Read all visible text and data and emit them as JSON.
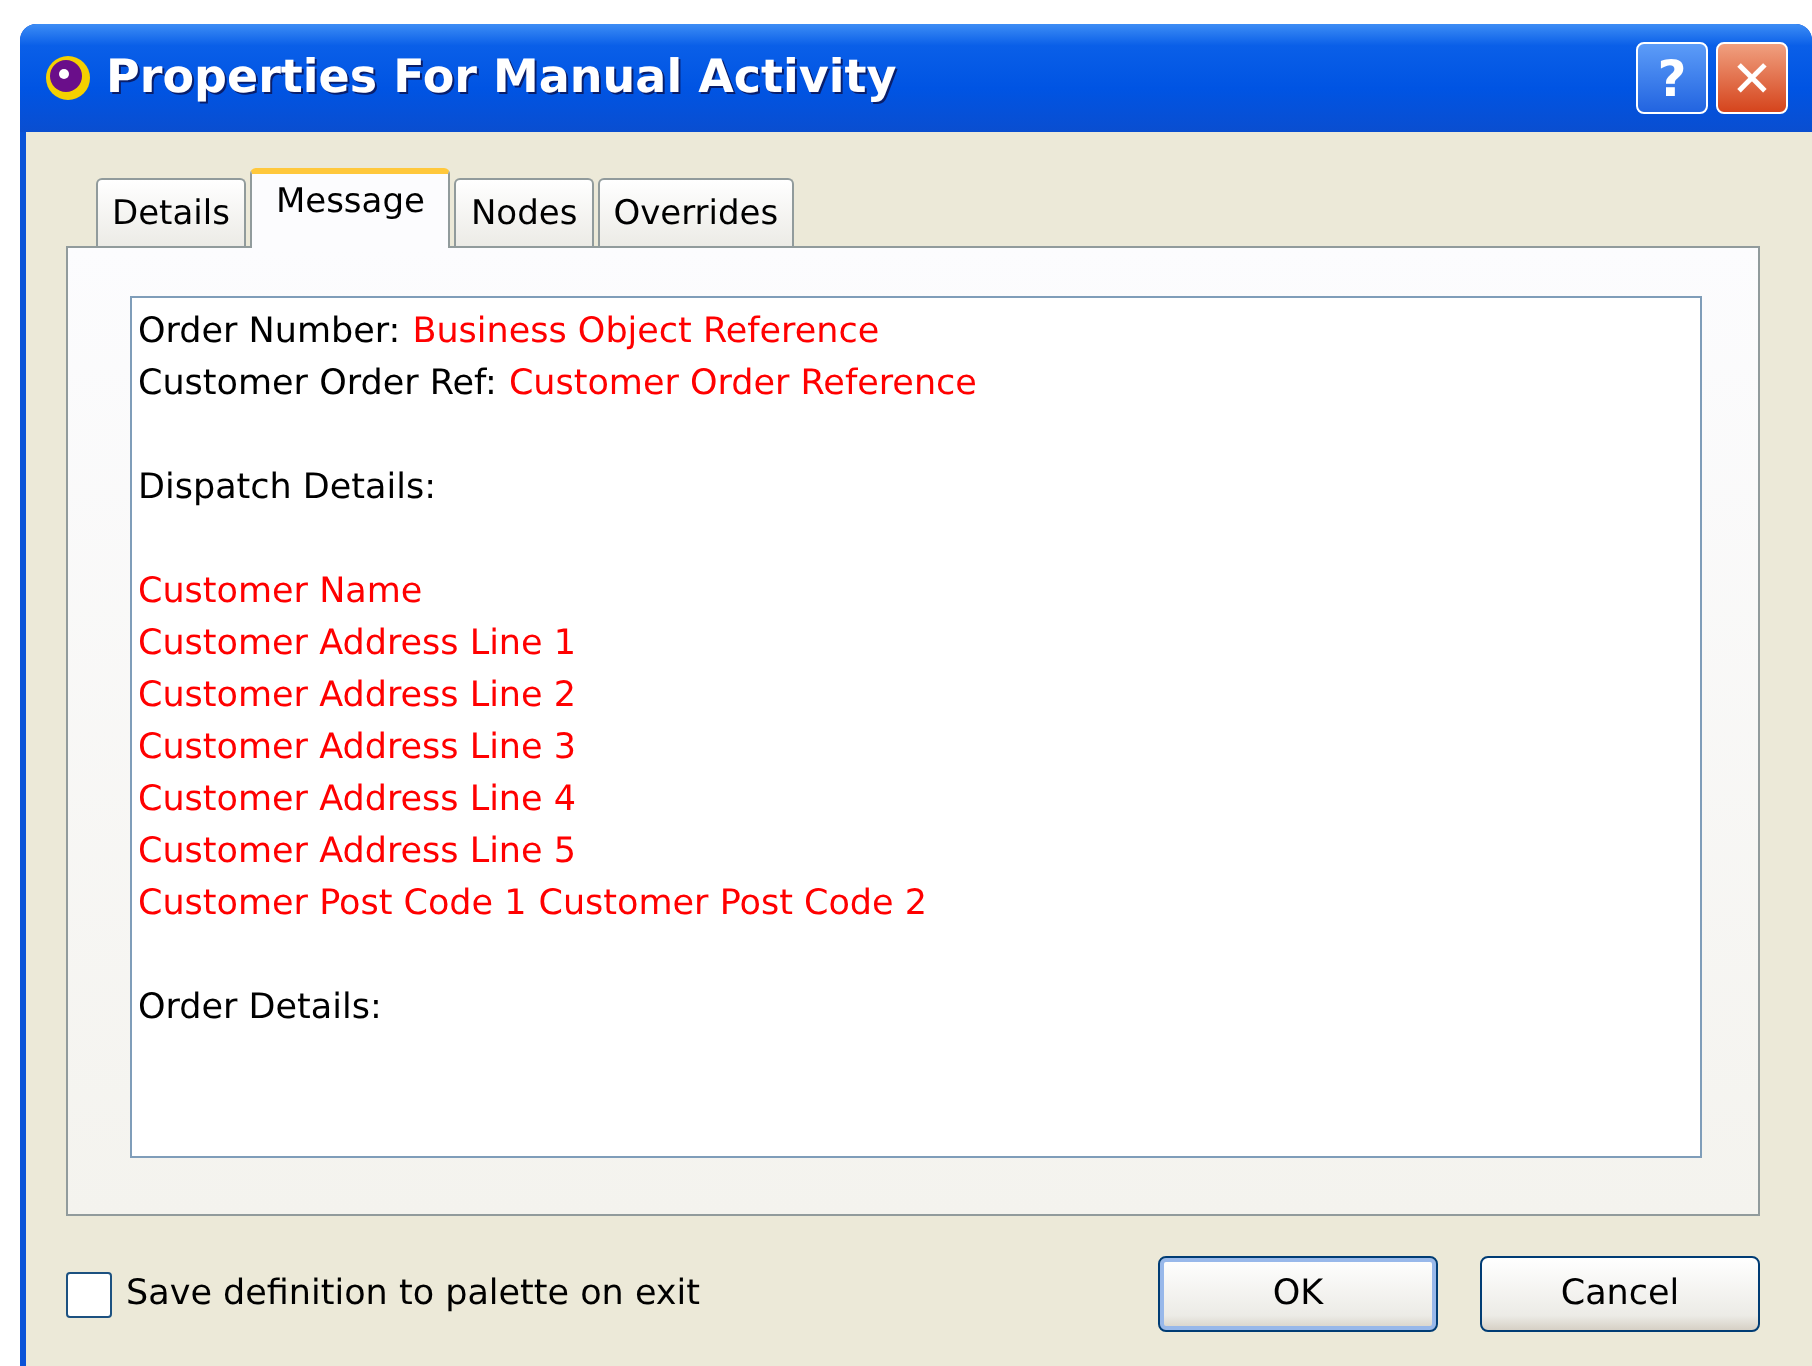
{
  "window": {
    "title": "Properties For Manual Activity",
    "help_button": "?",
    "close_button": "✕"
  },
  "tabs": [
    {
      "label": "Details",
      "selected": false
    },
    {
      "label": "Message",
      "selected": true
    },
    {
      "label": "Nodes",
      "selected": false
    },
    {
      "label": "Overrides",
      "selected": false
    }
  ],
  "message": {
    "blocks": [
      [
        {
          "segments": [
            {
              "kind": "plain",
              "text": "Order Number:"
            },
            {
              "kind": "field",
              "text": "Business Object Reference"
            }
          ]
        },
        {
          "segments": [
            {
              "kind": "plain",
              "text": "Customer Order Ref:"
            },
            {
              "kind": "field",
              "text": "Customer Order Reference"
            }
          ]
        }
      ],
      [
        {
          "segments": [
            {
              "kind": "plain",
              "text": "Dispatch Details:"
            }
          ]
        }
      ],
      [
        {
          "segments": [
            {
              "kind": "field",
              "text": "Customer Name"
            }
          ]
        },
        {
          "segments": [
            {
              "kind": "field",
              "text": "Customer Address Line 1"
            }
          ]
        },
        {
          "segments": [
            {
              "kind": "field",
              "text": "Customer Address Line 2"
            }
          ]
        },
        {
          "segments": [
            {
              "kind": "field",
              "text": "Customer Address Line 3"
            }
          ]
        },
        {
          "segments": [
            {
              "kind": "field",
              "text": "Customer Address Line 4"
            }
          ]
        },
        {
          "segments": [
            {
              "kind": "field",
              "text": "Customer Address Line 5"
            }
          ]
        },
        {
          "segments": [
            {
              "kind": "field",
              "text": "Customer Post Code 1"
            },
            {
              "kind": "field",
              "text": "Customer Post Code 2"
            }
          ]
        }
      ],
      [
        {
          "segments": [
            {
              "kind": "plain",
              "text": "Order Details:"
            }
          ]
        }
      ]
    ]
  },
  "save_to_palette": {
    "label": "Save definition to palette on exit",
    "checked": false
  },
  "buttons": [
    {
      "label": "OK",
      "default": true
    },
    {
      "label": "Cancel",
      "default": false
    }
  ]
}
